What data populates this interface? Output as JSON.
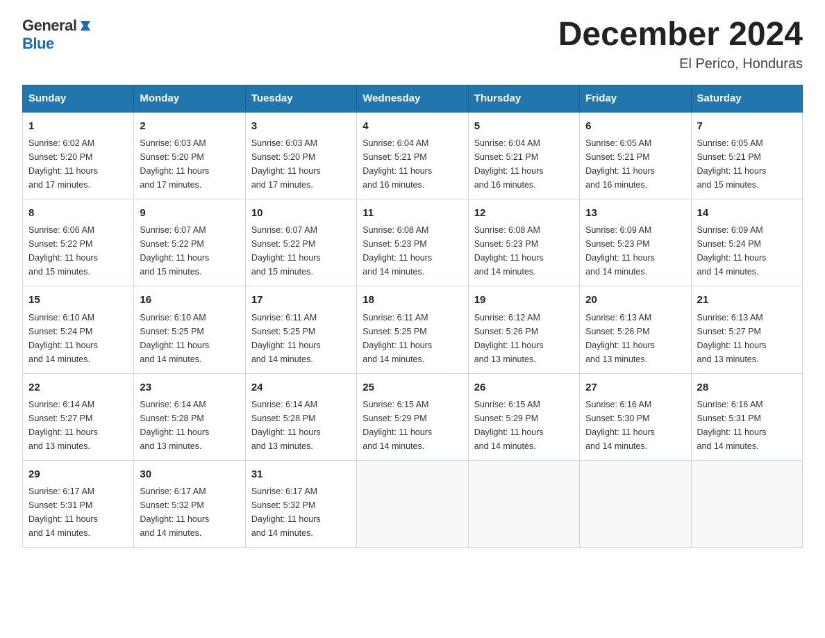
{
  "header": {
    "logo_line1": "General",
    "logo_line2": "Blue",
    "month_title": "December 2024",
    "location": "El Perico, Honduras"
  },
  "weekdays": [
    "Sunday",
    "Monday",
    "Tuesday",
    "Wednesday",
    "Thursday",
    "Friday",
    "Saturday"
  ],
  "weeks": [
    [
      {
        "day": "1",
        "sunrise": "6:02 AM",
        "sunset": "5:20 PM",
        "daylight": "11 hours and 17 minutes."
      },
      {
        "day": "2",
        "sunrise": "6:03 AM",
        "sunset": "5:20 PM",
        "daylight": "11 hours and 17 minutes."
      },
      {
        "day": "3",
        "sunrise": "6:03 AM",
        "sunset": "5:20 PM",
        "daylight": "11 hours and 17 minutes."
      },
      {
        "day": "4",
        "sunrise": "6:04 AM",
        "sunset": "5:21 PM",
        "daylight": "11 hours and 16 minutes."
      },
      {
        "day": "5",
        "sunrise": "6:04 AM",
        "sunset": "5:21 PM",
        "daylight": "11 hours and 16 minutes."
      },
      {
        "day": "6",
        "sunrise": "6:05 AM",
        "sunset": "5:21 PM",
        "daylight": "11 hours and 16 minutes."
      },
      {
        "day": "7",
        "sunrise": "6:05 AM",
        "sunset": "5:21 PM",
        "daylight": "11 hours and 15 minutes."
      }
    ],
    [
      {
        "day": "8",
        "sunrise": "6:06 AM",
        "sunset": "5:22 PM",
        "daylight": "11 hours and 15 minutes."
      },
      {
        "day": "9",
        "sunrise": "6:07 AM",
        "sunset": "5:22 PM",
        "daylight": "11 hours and 15 minutes."
      },
      {
        "day": "10",
        "sunrise": "6:07 AM",
        "sunset": "5:22 PM",
        "daylight": "11 hours and 15 minutes."
      },
      {
        "day": "11",
        "sunrise": "6:08 AM",
        "sunset": "5:23 PM",
        "daylight": "11 hours and 14 minutes."
      },
      {
        "day": "12",
        "sunrise": "6:08 AM",
        "sunset": "5:23 PM",
        "daylight": "11 hours and 14 minutes."
      },
      {
        "day": "13",
        "sunrise": "6:09 AM",
        "sunset": "5:23 PM",
        "daylight": "11 hours and 14 minutes."
      },
      {
        "day": "14",
        "sunrise": "6:09 AM",
        "sunset": "5:24 PM",
        "daylight": "11 hours and 14 minutes."
      }
    ],
    [
      {
        "day": "15",
        "sunrise": "6:10 AM",
        "sunset": "5:24 PM",
        "daylight": "11 hours and 14 minutes."
      },
      {
        "day": "16",
        "sunrise": "6:10 AM",
        "sunset": "5:25 PM",
        "daylight": "11 hours and 14 minutes."
      },
      {
        "day": "17",
        "sunrise": "6:11 AM",
        "sunset": "5:25 PM",
        "daylight": "11 hours and 14 minutes."
      },
      {
        "day": "18",
        "sunrise": "6:11 AM",
        "sunset": "5:25 PM",
        "daylight": "11 hours and 14 minutes."
      },
      {
        "day": "19",
        "sunrise": "6:12 AM",
        "sunset": "5:26 PM",
        "daylight": "11 hours and 13 minutes."
      },
      {
        "day": "20",
        "sunrise": "6:13 AM",
        "sunset": "5:26 PM",
        "daylight": "11 hours and 13 minutes."
      },
      {
        "day": "21",
        "sunrise": "6:13 AM",
        "sunset": "5:27 PM",
        "daylight": "11 hours and 13 minutes."
      }
    ],
    [
      {
        "day": "22",
        "sunrise": "6:14 AM",
        "sunset": "5:27 PM",
        "daylight": "11 hours and 13 minutes."
      },
      {
        "day": "23",
        "sunrise": "6:14 AM",
        "sunset": "5:28 PM",
        "daylight": "11 hours and 13 minutes."
      },
      {
        "day": "24",
        "sunrise": "6:14 AM",
        "sunset": "5:28 PM",
        "daylight": "11 hours and 13 minutes."
      },
      {
        "day": "25",
        "sunrise": "6:15 AM",
        "sunset": "5:29 PM",
        "daylight": "11 hours and 14 minutes."
      },
      {
        "day": "26",
        "sunrise": "6:15 AM",
        "sunset": "5:29 PM",
        "daylight": "11 hours and 14 minutes."
      },
      {
        "day": "27",
        "sunrise": "6:16 AM",
        "sunset": "5:30 PM",
        "daylight": "11 hours and 14 minutes."
      },
      {
        "day": "28",
        "sunrise": "6:16 AM",
        "sunset": "5:31 PM",
        "daylight": "11 hours and 14 minutes."
      }
    ],
    [
      {
        "day": "29",
        "sunrise": "6:17 AM",
        "sunset": "5:31 PM",
        "daylight": "11 hours and 14 minutes."
      },
      {
        "day": "30",
        "sunrise": "6:17 AM",
        "sunset": "5:32 PM",
        "daylight": "11 hours and 14 minutes."
      },
      {
        "day": "31",
        "sunrise": "6:17 AM",
        "sunset": "5:32 PM",
        "daylight": "11 hours and 14 minutes."
      },
      null,
      null,
      null,
      null
    ]
  ],
  "labels": {
    "sunrise": "Sunrise:",
    "sunset": "Sunset:",
    "daylight": "Daylight:"
  }
}
